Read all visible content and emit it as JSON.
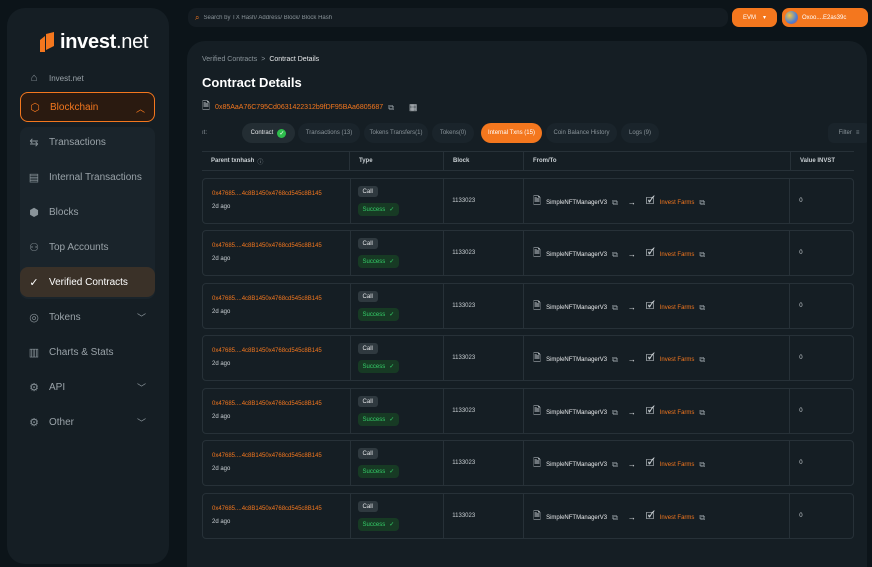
{
  "brand": {
    "logo_text_bold": "invest",
    "logo_text_light": ".net",
    "accent": "#f4771e"
  },
  "sidebar": {
    "items": [
      {
        "label": "Invest.net",
        "icon": "home-icon"
      },
      {
        "label": "Blockchain",
        "icon": "cube-icon"
      },
      {
        "label": "Transactions",
        "icon": "transfer-icon"
      },
      {
        "label": "Internal Transactions",
        "icon": "document-icon"
      },
      {
        "label": "Blocks",
        "icon": "blocks-icon"
      },
      {
        "label": "Top Accounts",
        "icon": "user-icon"
      },
      {
        "label": "Verified Contracts",
        "icon": "verified-icon"
      },
      {
        "label": "Tokens",
        "icon": "token-icon"
      },
      {
        "label": "Charts & Stats",
        "icon": "chart-icon"
      },
      {
        "label": "API",
        "icon": "api-icon"
      },
      {
        "label": "Other",
        "icon": "gear-icon"
      }
    ]
  },
  "topbar": {
    "search_placeholder": "Search by TX Hash/ Address/ Block/ Block Hash",
    "network": "EVM",
    "wallet": "Oxoo....E2as39c"
  },
  "breadcrumb": {
    "parent": "Verified Contracts",
    "separator": ">",
    "current": "Contract Details"
  },
  "page": {
    "title": "Contract Details",
    "address": "0x85AaA76C795Cd0631422312b9fDF95BAa6805687"
  },
  "tabs": [
    {
      "label": "ıt:"
    },
    {
      "label": "Contract"
    },
    {
      "label": "Transactions (13)"
    },
    {
      "label": "Tokens Transfers(1)"
    },
    {
      "label": "Tokens(0)"
    },
    {
      "label": "Internal Txns (15)"
    },
    {
      "label": "Coin Balance History"
    },
    {
      "label": "Logs (9)"
    }
  ],
  "filter_label": "Filter",
  "table": {
    "headers": [
      "Parent txnhash",
      "Type",
      "Block",
      "From/To",
      "Value INVST"
    ],
    "rows": [
      {
        "hash": "0x47685....4c8B1450x4768cd545c8B145",
        "age": "2d ago",
        "type": "Call",
        "status": "Success",
        "block": "1133023",
        "from": "SimpleNFTManagerV3",
        "to": "Invest Farms",
        "value": "0"
      },
      {
        "hash": "0x47685....4c8B1450x4768cd545c8B145",
        "age": "2d ago",
        "type": "Call",
        "status": "Success",
        "block": "1133023",
        "from": "SimpleNFTManagerV3",
        "to": "Invest Farms",
        "value": "0"
      },
      {
        "hash": "0x47685....4c8B1450x4768cd545c8B145",
        "age": "2d ago",
        "type": "Call",
        "status": "Success",
        "block": "1133023",
        "from": "SimpleNFTManagerV3",
        "to": "Invest Farms",
        "value": "0"
      },
      {
        "hash": "0x47685....4c8B1450x4768cd545c8B145",
        "age": "2d ago",
        "type": "Call",
        "status": "Success",
        "block": "1133023",
        "from": "SimpleNFTManagerV3",
        "to": "Invest Farms",
        "value": "0"
      },
      {
        "hash": "0x47685....4c8B1450x4768cd545c8B145",
        "age": "2d ago",
        "type": "Call",
        "status": "Success",
        "block": "1133023",
        "from": "SimpleNFTManagerV3",
        "to": "Invest Farms",
        "value": "0"
      },
      {
        "hash": "0x47685....4c8B1450x4768cd545c8B145",
        "age": "2d ago",
        "type": "Call",
        "status": "Success",
        "block": "1133023",
        "from": "SimpleNFTManagerV3",
        "to": "Invest Farms",
        "value": "0"
      },
      {
        "hash": "0x47685....4c8B1450x4768cd545c8B145",
        "age": "2d ago",
        "type": "Call",
        "status": "Success",
        "block": "1133023",
        "from": "SimpleNFTManagerV3",
        "to": "Invest Farms",
        "value": "0"
      }
    ]
  }
}
